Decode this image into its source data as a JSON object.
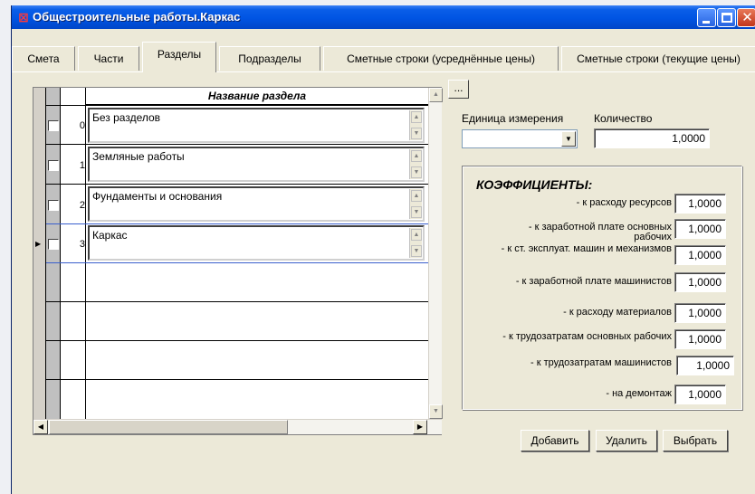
{
  "window": {
    "title": "Общестроительные работы.Каркас",
    "app_icon": "red-app-icon"
  },
  "tabs": [
    {
      "label": "Смета",
      "active": false
    },
    {
      "label": "Части",
      "active": false
    },
    {
      "label": "Разделы",
      "active": true
    },
    {
      "label": "Подразделы",
      "active": false
    },
    {
      "label": "Сметные строки (усреднённые цены)",
      "active": false
    },
    {
      "label": "Сметные строки (текущие цены)",
      "active": false
    }
  ],
  "grid": {
    "header": "Название раздела",
    "rows": [
      {
        "num": "0",
        "name": "Без разделов"
      },
      {
        "num": "1",
        "name": "Земляные работы"
      },
      {
        "num": "2",
        "name": "Фундаменты  и основания"
      },
      {
        "num": "3",
        "name": "Каркас",
        "current": true
      }
    ]
  },
  "ellipsis_button": "...",
  "unit": {
    "label": "Единица измерения",
    "value": ""
  },
  "quantity": {
    "label": "Количество",
    "value": "1,0000"
  },
  "coefficients": {
    "title": "КОЭФФИЦИЕНТЫ:",
    "items": [
      {
        "label": "- к расходу ресурсов",
        "value": "1,0000"
      },
      {
        "label": "- к заработной плате основных рабочих",
        "value": "1,0000"
      },
      {
        "label": "- к ст. эксплуат. машин и механизмов",
        "value": "1,0000"
      },
      {
        "label": "- к заработной плате машинистов",
        "value": "1,0000"
      },
      {
        "label": "- к расходу материалов",
        "value": "1,0000"
      },
      {
        "label": "- к трудозатратам основных рабочих",
        "value": "1,0000"
      },
      {
        "label": "- к трудозатратам машинистов",
        "value": "1,0000"
      },
      {
        "label": "- на демонтаж",
        "value": "1,0000"
      }
    ]
  },
  "buttons": {
    "add": "Добавить",
    "delete": "Удалить",
    "select": "Выбрать"
  }
}
